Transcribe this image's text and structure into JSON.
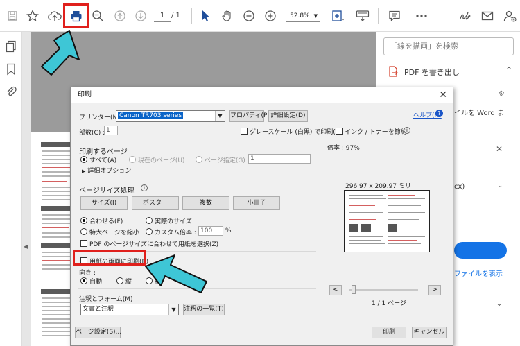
{
  "toolbar": {
    "page_current": "1",
    "page_total": "/ 1",
    "zoom": "52.8%"
  },
  "right_pane": {
    "search_placeholder": "「線を描画」を検索",
    "export_title": "PDF を書き出し",
    "export_desc": "イルを Word ま",
    "format_partial": "cx)",
    "show_file": "ファイルを表示"
  },
  "dialog": {
    "title": "印刷",
    "printer_label": "プリンター(N) :",
    "printer_value": "Canon TR703 series",
    "properties_button": "プロパティ(P)",
    "advanced_button": "詳細設定(D)",
    "help_link": "ヘルプ(H)",
    "copies_label": "部数(C) :",
    "copies_value": "1",
    "grayscale_label": "グレースケール (白黒) で印刷(Y)",
    "ink_save_label": "インク / トナーを節約",
    "pages_section": "印刷するページ",
    "pages_all": "すべて(A)",
    "pages_current": "現在のページ(U)",
    "pages_specified": "ページ指定(G)",
    "pages_specified_value": "1",
    "more_options": "詳細オプション",
    "size_section": "ページサイズ処理",
    "size_buttons": [
      "サイズ(I)",
      "ポスター",
      "複数",
      "小冊子"
    ],
    "fit_label": "合わせる(F)",
    "actual_size_label": "実際のサイズ",
    "shrink_label": "特大ページを縮小",
    "custom_scale_label": "カスタム倍率 :",
    "custom_scale_value": "100",
    "percent": "%",
    "paper_by_pdf_label": "PDF のページサイズに合わせて用紙を選択(Z)",
    "duplex_label": "用紙の両面に印刷(B)",
    "orientation_label": "向き :",
    "orient_auto": "自動",
    "orient_portrait": "縦",
    "orient_landscape": "横",
    "comments_section": "注釈とフォーム(M)",
    "comments_value": "文書と注釈",
    "comments_list_button": "注釈の一覧(T)",
    "zoom_label": "倍率 : 97%",
    "paper_size": "296.97 x 209.97 ミリ",
    "page_indicator": "1 / 1 ページ",
    "prev_button": "<",
    "next_button": ">",
    "page_setup_button": "ページ設定(S)...",
    "print_button": "印刷",
    "cancel_button": "キャンセル"
  },
  "colors": {
    "annotation_red": "#e0201c",
    "annotation_arrow": "#3ec6d6",
    "printer_highlight": "#0a64c8",
    "adobe_blue": "#1473e6"
  }
}
